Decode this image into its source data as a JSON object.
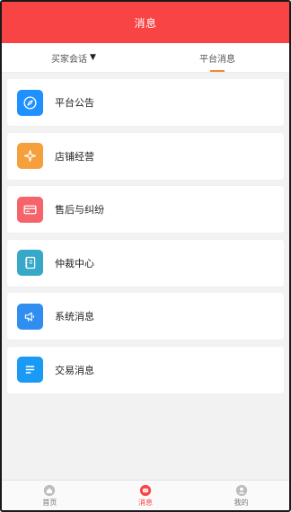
{
  "header": {
    "title": "消息"
  },
  "tabs": [
    {
      "label": "买家会话",
      "caret": "▼",
      "active": false
    },
    {
      "label": "平台消息",
      "active": true
    }
  ],
  "list": [
    {
      "label": "平台公告",
      "icon": "compass-icon",
      "color": "#1e90ff"
    },
    {
      "label": "店铺经营",
      "icon": "sparkle-icon",
      "color": "#f5a03c"
    },
    {
      "label": "售后与纠纷",
      "icon": "card-icon",
      "color": "#f4646a"
    },
    {
      "label": "仲裁中心",
      "icon": "document-icon",
      "color": "#38a8c8"
    },
    {
      "label": "系统消息",
      "icon": "megaphone-icon",
      "color": "#2f8ef0"
    },
    {
      "label": "交易消息",
      "icon": "lines-icon",
      "color": "#1a9af5"
    }
  ],
  "tabbar": [
    {
      "label": "首页",
      "icon": "home-icon",
      "active": false
    },
    {
      "label": "消息",
      "icon": "message-icon",
      "active": true
    },
    {
      "label": "我的",
      "icon": "user-icon",
      "active": false
    }
  ],
  "colors": {
    "header": "#f94446",
    "accent_underline": "#f5862e"
  }
}
